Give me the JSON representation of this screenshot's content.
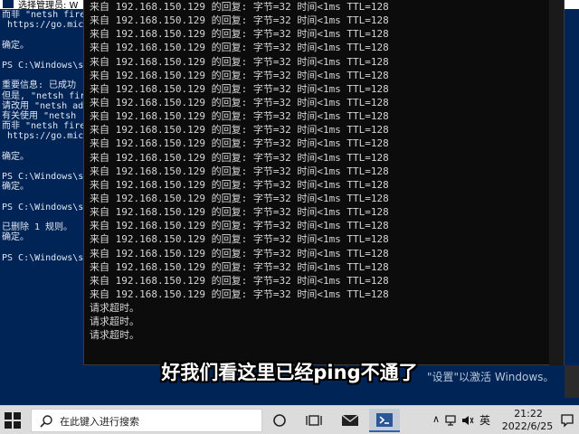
{
  "ps_window": {
    "title": "选择管理员: W",
    "lines": [
      "而非 \"netsh fire",
      " https://go.micr",
      "",
      "确定。",
      "",
      "PS C:\\Windows\\sy",
      "",
      "重要信息: 已成功",
      "但是, \"netsh fir",
      "请改用 \"netsh ad",
      "有关使用 \"netsh ",
      "而非 \"netsh fire",
      " https://go.micr",
      "",
      "确定。",
      "",
      "PS C:\\Windows\\sy",
      "确定。",
      "",
      "PS C:\\Windows\\sy",
      "",
      "已删除 1 规则。",
      "确定。",
      "",
      "PS C:\\Windows\\sy"
    ]
  },
  "cmd_window": {
    "lines": [
      "来自 192.168.150.129 的回复: 字节=32 时间<1ms TTL=128",
      "来自 192.168.150.129 的回复: 字节=32 时间<1ms TTL=128",
      "来自 192.168.150.129 的回复: 字节=32 时间<1ms TTL=128",
      "来自 192.168.150.129 的回复: 字节=32 时间<1ms TTL=128",
      "来自 192.168.150.129 的回复: 字节=32 时间<1ms TTL=128",
      "来自 192.168.150.129 的回复: 字节=32 时间<1ms TTL=128",
      "来自 192.168.150.129 的回复: 字节=32 时间<1ms TTL=128",
      "来自 192.168.150.129 的回复: 字节=32 时间<1ms TTL=128",
      "来自 192.168.150.129 的回复: 字节=32 时间<1ms TTL=128",
      "来自 192.168.150.129 的回复: 字节=32 时间<1ms TTL=128",
      "来自 192.168.150.129 的回复: 字节=32 时间<1ms TTL=128",
      "来自 192.168.150.129 的回复: 字节=32 时间<1ms TTL=128",
      "来自 192.168.150.129 的回复: 字节=32 时间<1ms TTL=128",
      "来自 192.168.150.129 的回复: 字节=32 时间<1ms TTL=128",
      "来自 192.168.150.129 的回复: 字节=32 时间<1ms TTL=128",
      "来自 192.168.150.129 的回复: 字节=32 时间<1ms TTL=128",
      "来自 192.168.150.129 的回复: 字节=32 时间<1ms TTL=128",
      "来自 192.168.150.129 的回复: 字节=32 时间<1ms TTL=128",
      "来自 192.168.150.129 的回复: 字节=32 时间<1ms TTL=128",
      "来自 192.168.150.129 的回复: 字节=32 时间<1ms TTL=128",
      "来自 192.168.150.129 的回复: 字节=32 时间<1ms TTL=128",
      "来自 192.168.150.129 的回复: 字节=32 时间<1ms TTL=128",
      "请求超时。",
      "请求超时。",
      "请求超时。"
    ]
  },
  "subtitle": "好我们看这里已经ping不通了",
  "watermark": "\"设置\"以激活 Windows。",
  "taskbar": {
    "search_placeholder": "在此键入进行搜索",
    "ime": "英",
    "time": "21:22",
    "date": "2022/6/25"
  },
  "colors": {
    "ps_background": "#012456",
    "cmd_background": "#0c0c0c",
    "taskbar": "#dcdcdc",
    "accent": "#2a64b0"
  }
}
